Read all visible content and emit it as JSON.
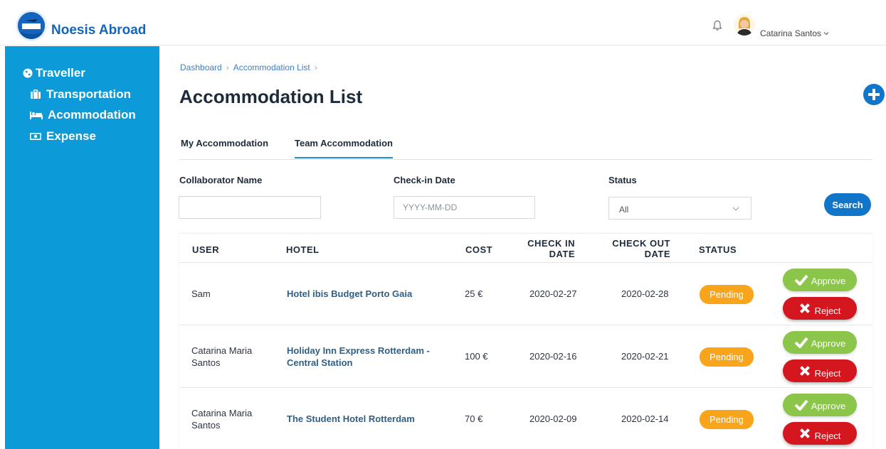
{
  "app": {
    "name": "Noesis Abroad"
  },
  "header": {
    "user_name": "Catarina Santos"
  },
  "sidebar": {
    "section": "Traveller",
    "items": [
      {
        "label": "Transportation",
        "icon": "briefcase-icon"
      },
      {
        "label": "Acommodation",
        "icon": "bed-icon"
      },
      {
        "label": "Expense",
        "icon": "money-icon"
      }
    ]
  },
  "breadcrumb": {
    "items": [
      "Dashboard",
      "Accommodation List"
    ]
  },
  "page": {
    "title": "Accommodation List"
  },
  "tabs": [
    {
      "label": "My Accommodation",
      "active": false
    },
    {
      "label": "Team Accommodation",
      "active": true
    }
  ],
  "filters": {
    "collaborator_label": "Collaborator Name",
    "collaborator_value": "",
    "checkin_label": "Check-in Date",
    "checkin_placeholder": "YYYY-MM-DD",
    "status_label": "Status",
    "status_value": "All",
    "search_label": "Search"
  },
  "table": {
    "headers": {
      "user": "USER",
      "hotel": "HOTEL",
      "cost": "COST",
      "checkin_1": "CHECK IN",
      "checkin_2": "DATE",
      "checkout_1": "CHECK OUT",
      "checkout_2": "DATE",
      "status": "STATUS"
    },
    "rows": [
      {
        "user": "Sam",
        "hotel": "Hotel ibis Budget Porto Gaia",
        "cost": "25 €",
        "checkin": "2020-02-27",
        "checkout": "2020-02-28",
        "status": "Pending"
      },
      {
        "user": "Catarina Maria Santos",
        "hotel": "Holiday Inn Express Rotterdam - Central Station",
        "cost": "100 €",
        "checkin": "2020-02-16",
        "checkout": "2020-02-21",
        "status": "Pending"
      },
      {
        "user": "Catarina Maria Santos",
        "hotel": "The Student Hotel Rotterdam",
        "cost": "70 €",
        "checkin": "2020-02-09",
        "checkout": "2020-02-14",
        "status": "Pending"
      }
    ],
    "approve_label": "Approve",
    "reject_label": "Reject"
  },
  "colors": {
    "sidebar": "#0d9ad8",
    "primary": "#1176c9",
    "pending": "#f8a51b",
    "approve": "#8bc54a",
    "reject": "#d4161e"
  }
}
